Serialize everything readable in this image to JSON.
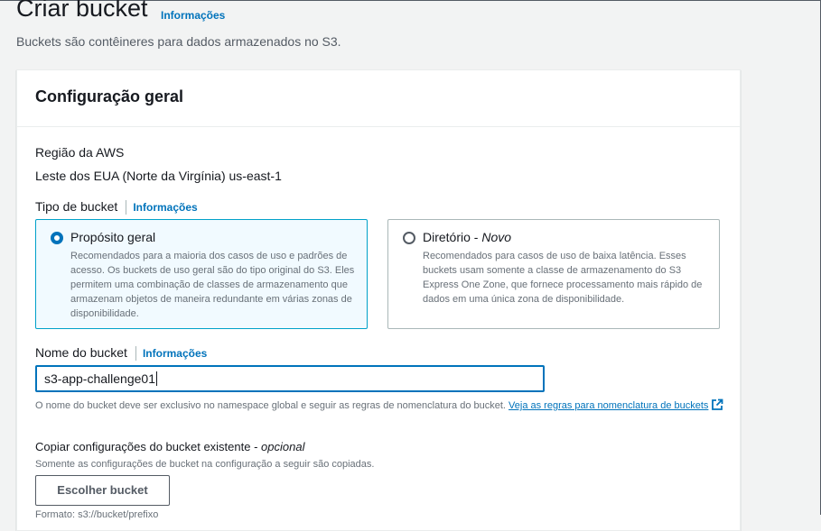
{
  "header": {
    "title": "Criar bucket",
    "info_link": "Informações",
    "description": "Buckets são contêineres para dados armazenados no S3."
  },
  "general_config": {
    "title": "Configuração geral",
    "region_label": "Região da AWS",
    "region_value": "Leste dos EUA (Norte da Virgínia) us-east-1",
    "bucket_type_label": "Tipo de bucket",
    "bucket_type_info": "Informações",
    "options": [
      {
        "title": "Propósito geral",
        "suffix": "",
        "selected": true,
        "description": "Recomendados para a maioria dos casos de uso e padrões de acesso. Os buckets de uso geral são do tipo original do S3. Eles permitem uma combinação de classes de armazenamento que armazenam objetos de maneira redundante em várias zonas de disponibilidade."
      },
      {
        "title": "Diretório - ",
        "suffix": "Novo",
        "selected": false,
        "description": "Recomendados para casos de uso de baixa latência. Esses buckets usam somente a classe de armazenamento do S3 Express One Zone, que fornece processamento mais rápido de dados em uma única zona de disponibilidade."
      }
    ],
    "bucket_name_label": "Nome do bucket",
    "bucket_name_info": "Informações",
    "bucket_name_value": "s3-app-challenge01",
    "bucket_name_hint": "O nome do bucket deve ser exclusivo no namespace global e seguir as regras de nomenclatura do bucket.",
    "bucket_name_link": "Veja as regras para nomenclatura de buckets",
    "copy_title": "Copiar configurações do bucket existente - ",
    "copy_optional": "opcional",
    "copy_description": "Somente as configurações de bucket na configuração a seguir são copiadas.",
    "choose_button": "Escolher bucket",
    "cut_off_text": "Formato: s3://bucket/prefixo"
  },
  "colors": {
    "link": "#0073bb",
    "selected_tile_bg": "#f1faff",
    "selected_tile_border": "#00a1c9"
  }
}
